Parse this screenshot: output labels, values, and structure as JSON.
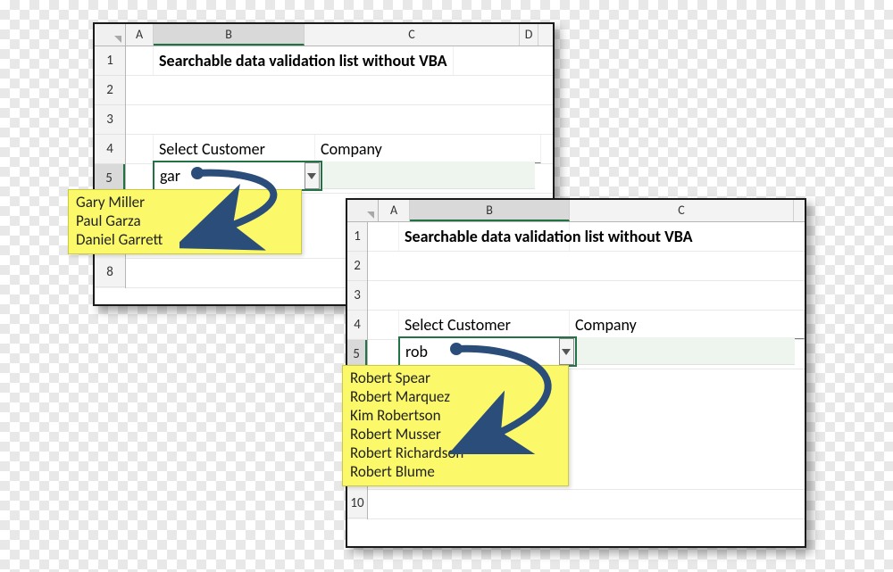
{
  "panel1": {
    "columns": [
      "A",
      "B",
      "C",
      "D"
    ],
    "rows": [
      "1",
      "2",
      "3",
      "4",
      "5",
      "8"
    ],
    "title": "Searchable data validation list without VBA",
    "label_select": "Select Customer",
    "label_company": "Company",
    "input_value": "gar",
    "suggestions": [
      "Gary Miller",
      "Paul Garza",
      "Daniel Garrett"
    ]
  },
  "panel2": {
    "columns": [
      "A",
      "B",
      "C"
    ],
    "rows": [
      "1",
      "2",
      "3",
      "4",
      "5",
      "10"
    ],
    "title": "Searchable data validation list without VBA",
    "label_select": "Select Customer",
    "label_company": "Company",
    "input_value": "rob",
    "suggestions": [
      "Robert Spear",
      "Robert Marquez",
      "Kim Robertson",
      "Robert Musser",
      "Robert Richardson",
      "Robert Blume"
    ]
  }
}
